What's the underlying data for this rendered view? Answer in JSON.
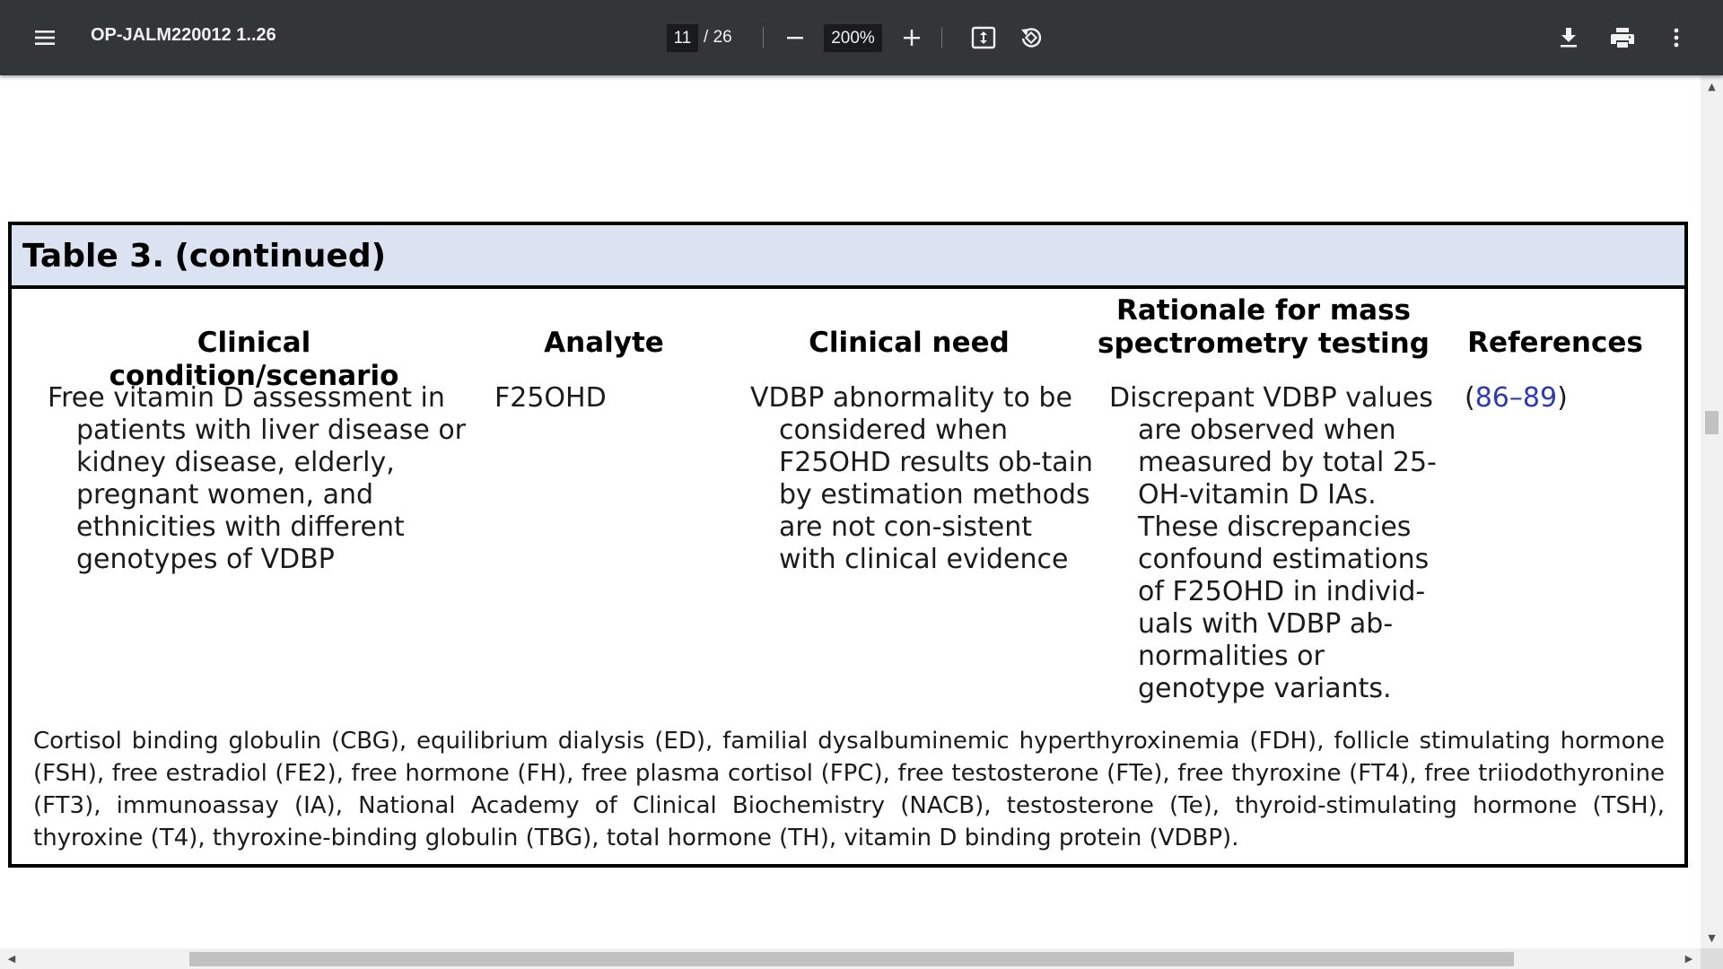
{
  "toolbar": {
    "title": "OP-JALM220012 1..26",
    "page_current": "11",
    "page_separator": "/",
    "page_total": "26",
    "zoom": "200%",
    "icons": {
      "menu": "hamburger-menu-icon",
      "zoom_out": "minus-icon",
      "zoom_in": "plus-icon",
      "fit": "fit-page-icon",
      "rotate": "rotate-icon",
      "download": "download-icon",
      "print": "print-icon",
      "more": "more-vertical-icon"
    },
    "colors": {
      "bar": "#323639",
      "text": "#f1f1f1",
      "input_bg": "#191b1c"
    }
  },
  "document": {
    "table": {
      "caption_number": "Table 3.",
      "caption_rest": "(continued)",
      "headers": [
        "Clinical condition/scenario",
        "Analyte",
        "Clinical need",
        "Rationale for mass\nspectrometry testing",
        "References"
      ],
      "row": {
        "condition": "Free vitamin D assessment in patients with liver disease or kidney disease, elderly, pregnant women, and ethnicities with different genotypes of VDBP",
        "analyte": "F25OHD",
        "clinical_need": "VDBP abnormality to be considered when F25OHD results ob-tain by estimation methods are not con-sistent with clinical evidence",
        "rationale": "Discrepant VDBP values are observed when measured by total 25-OH-vitamin D IAs. These discrepancies confound estimations of F25OHD in individ-uals with VDBP ab-normalities or genotype variants.",
        "ref_open": "(",
        "ref_link": "86–89",
        "ref_close": ")"
      },
      "footnote": "Cortisol binding globulin (CBG), equilibrium dialysis (ED), familial dysalbuminemic hyperthyroxinemia (FDH), follicle stimulating hormone (FSH), free estradiol (FE2), free hormone (FH), free plasma cortisol (FPC), free testosterone (FTe), free thyroxine (FT4), free triiodothyronine (FT3), immunoassay (IA), National Academy of Clinical Biochemistry (NACB), testosterone (Te), thyroid-stimulating hormone (TSH), thyroxine (T4), thyroxine-binding globulin (TBG), total hormone (TH), vitamin D binding protein (VDBP).",
      "colors": {
        "caption_bg": "#dbe2f1",
        "border": "#000000",
        "link": "#2c3bb5"
      }
    }
  },
  "scrollbars": {
    "up_arrow": "▲",
    "down_arrow": "▼",
    "left_arrow": "◀",
    "right_arrow": "▶"
  }
}
